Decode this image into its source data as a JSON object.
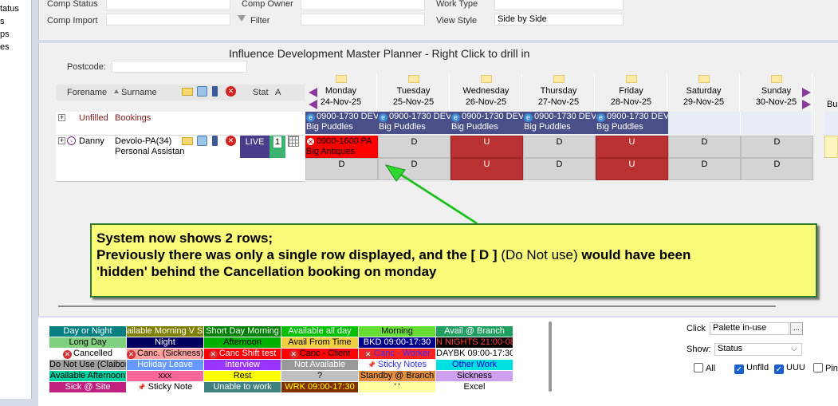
{
  "left_panel": {
    "items": [
      "tatus",
      "s",
      "ps",
      "es"
    ]
  },
  "filters": {
    "comp_status_label": "Comp Status",
    "comp_owner_label": "Comp Owner",
    "work_type_label": "Work Type",
    "comp_import_label": "Comp Import",
    "filter_label": "Filter",
    "view_style_label": "View Style",
    "view_style_value": "Side by Side"
  },
  "planner": {
    "title": "Influence Development Master Planner  -  Right Click to drill in",
    "postcode_label": "Postcode:",
    "columns": {
      "forename": "Forename",
      "surname": "Surname",
      "stat": "Stat",
      "a": "A"
    },
    "days": [
      {
        "name": "Monday",
        "date": "24-Nov-25"
      },
      {
        "name": "Tuesday",
        "date": "25-Nov-25"
      },
      {
        "name": "Wednesday",
        "date": "26-Nov-25"
      },
      {
        "name": "Thursday",
        "date": "27-Nov-25"
      },
      {
        "name": "Friday",
        "date": "28-Nov-25"
      },
      {
        "name": "Saturday",
        "date": "29-Nov-25"
      },
      {
        "name": "Sunday",
        "date": "30-Nov-25"
      }
    ],
    "overflow_col": "Bu",
    "unfilled_row": {
      "expand": "+",
      "forename": "Unfilled",
      "surname": "Bookings",
      "booking_time": "0900-1730 DEV",
      "booking_client": "Big Puddles"
    },
    "worker_row": {
      "expand": "+",
      "forename": "Danny",
      "surname": "Devolo-PA(34)",
      "role": "Personal Assistan",
      "status": "LIVE",
      "a_value": "1",
      "monday_booking": "0900-1600 PA",
      "monday_client": "Big Antiques",
      "row1": [
        "",
        "D",
        "U",
        "D",
        "U",
        "D",
        "D"
      ],
      "row2": [
        "D",
        "D",
        "U",
        "D",
        "U",
        "D",
        "D"
      ]
    }
  },
  "note": {
    "line1": "System now shows 2 rows;",
    "line2a": "Previously there was only a single row displayed, and the [ D ] ",
    "line2b": "(Do Not use)",
    "line2c": " would have been",
    "line3": "'hidden' behind the Cancellation booking on monday"
  },
  "legend": {
    "cells": [
      {
        "text": "Day or Night",
        "bg": "#008080",
        "fg": "#ffffff"
      },
      {
        "text": "ailable Morning V St",
        "bg": "#808000",
        "fg": "#ffffff"
      },
      {
        "text": "Short Day Morning",
        "bg": "#008000",
        "fg": "#ffffff"
      },
      {
        "text": "Available all day",
        "bg": "#00c000",
        "fg": "#ffffff"
      },
      {
        "text": "Morning",
        "bg": "#66dd33",
        "fg": "#000000"
      },
      {
        "text": "Avail @ Branch",
        "bg": "#20a060",
        "fg": "#ffffff"
      },
      {
        "text": "Long Day",
        "bg": "#80d080",
        "fg": "#000000"
      },
      {
        "text": "Night",
        "bg": "#000060",
        "fg": "#ffffff"
      },
      {
        "text": "Afternoon",
        "bg": "#00b000",
        "fg": "#000000"
      },
      {
        "text": "Avail From Time",
        "bg": "#f0d040",
        "fg": "#000000"
      },
      {
        "text": "BKD 09:00-17:30",
        "bg": "#00008b",
        "fg": "#ffffff"
      },
      {
        "text": "N NIGHTS 21:00-08",
        "bg": "#000000",
        "fg": "#ff4040"
      },
      {
        "text": "Cancelled",
        "bg": "#ffffff",
        "fg": "#000000",
        "icon": "x"
      },
      {
        "text": "Canc. (Sickness)",
        "bg": "#ffa0a0",
        "fg": "#000000",
        "icon": "x"
      },
      {
        "text": "Canc Shift test",
        "bg": "#ff0000",
        "fg": "#ffffff",
        "icon": "x"
      },
      {
        "text": "Canc - Client",
        "bg": "#ff0000",
        "fg": "#000000",
        "icon": "x"
      },
      {
        "text": "Canc - Worker",
        "bg": "#ff2020",
        "fg": "#3030ff",
        "icon": "x"
      },
      {
        "text": "DAYBK 09:00-17:30",
        "bg": "#ffffff",
        "fg": "#000000"
      },
      {
        "text": "Do Not Use (Claibon",
        "bg": "#a0a0a0",
        "fg": "#000000"
      },
      {
        "text": "Holiday Leave",
        "bg": "#6699ff",
        "fg": "#ffffff"
      },
      {
        "text": "Interview",
        "bg": "#9933ff",
        "fg": "#ffffff"
      },
      {
        "text": "Not Available",
        "bg": "#999999",
        "fg": "#ffffff"
      },
      {
        "text": "Sticky Notes",
        "bg": "#ffffff",
        "fg": "#3030ff",
        "icon": "pin"
      },
      {
        "text": "Other Work",
        "bg": "#00e0e0",
        "fg": "#0000cc"
      },
      {
        "text": "Available Afternoon",
        "bg": "#00d0a0",
        "fg": "#000000"
      },
      {
        "text": "xxx",
        "bg": "#ff6699",
        "fg": "#000000"
      },
      {
        "text": "Rest",
        "bg": "#ffff00",
        "fg": "#000000"
      },
      {
        "text": "?",
        "bg": "#c0c0c0",
        "fg": "#000000"
      },
      {
        "text": "Standby @ Branch",
        "bg": "#e09040",
        "fg": "#000000"
      },
      {
        "text": "Sickness",
        "bg": "#d0a0f0",
        "fg": "#000000"
      },
      {
        "text": "Sick @ Site",
        "bg": "#c02080",
        "fg": "#ffffff"
      },
      {
        "text": "Sticky Note",
        "bg": "#ffffff",
        "fg": "#000000",
        "icon": "pin"
      },
      {
        "text": "Unable to work",
        "bg": "#408080",
        "fg": "#ffffff"
      },
      {
        "text": "WRK 09:00-17:30",
        "bg": "#803000",
        "fg": "#ffff00"
      },
      {
        "text": "' '",
        "bg": "#ffffa0",
        "fg": "#000000"
      },
      {
        "text": "Excel",
        "bg": "#ffffff",
        "fg": "#000000"
      }
    ]
  },
  "options": {
    "click_label": "Click",
    "click_value": "Palette in-use",
    "click_btn": "...",
    "show_label": "Show:",
    "show_value": "Status",
    "all_label": "All",
    "unflld_label": "Unflld",
    "uuu_label": "UUU",
    "pin_label": "Pin"
  }
}
